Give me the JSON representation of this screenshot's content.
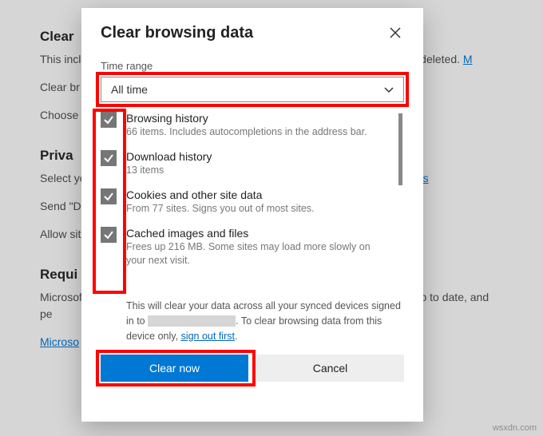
{
  "background": {
    "heading_clear": "Clear",
    "clear_desc_prefix": "This incl",
    "clear_desc_suffix": "rofile will be deleted. ",
    "clear_desc_link": "M",
    "p_clear_br": "Clear br",
    "p_choose": "Choose",
    "heading_privacy": "Priva",
    "p_select": "Select yo",
    "link_settings": "ettings",
    "p_send": "Send \"D",
    "p_allow": "Allow sit",
    "heading_require": "Requi",
    "p_microsoft": "Microsof",
    "p_ms_suffix": "ure, up to date, and pe",
    "link_microso": "Microso"
  },
  "dialog": {
    "title": "Clear browsing data",
    "time_range_label": "Time range",
    "time_range_value": "All time",
    "items": [
      {
        "title": "Browsing history",
        "sub": "66 items. Includes autocompletions in the address bar."
      },
      {
        "title": "Download history",
        "sub": "13 items"
      },
      {
        "title": "Cookies and other site data",
        "sub": "From 77 sites. Signs you out of most sites."
      },
      {
        "title": "Cached images and files",
        "sub": "Frees up 216 MB. Some sites may load more slowly on your next visit."
      }
    ],
    "sync_note_pre": "This will clear your data across all your synced devices signed in to ",
    "sync_note_mid": ". To clear browsing data from this device only, ",
    "sync_note_link": "sign out first",
    "sync_note_post": ".",
    "clear_btn": "Clear now",
    "cancel_btn": "Cancel"
  },
  "watermark": "wsxdn.com"
}
